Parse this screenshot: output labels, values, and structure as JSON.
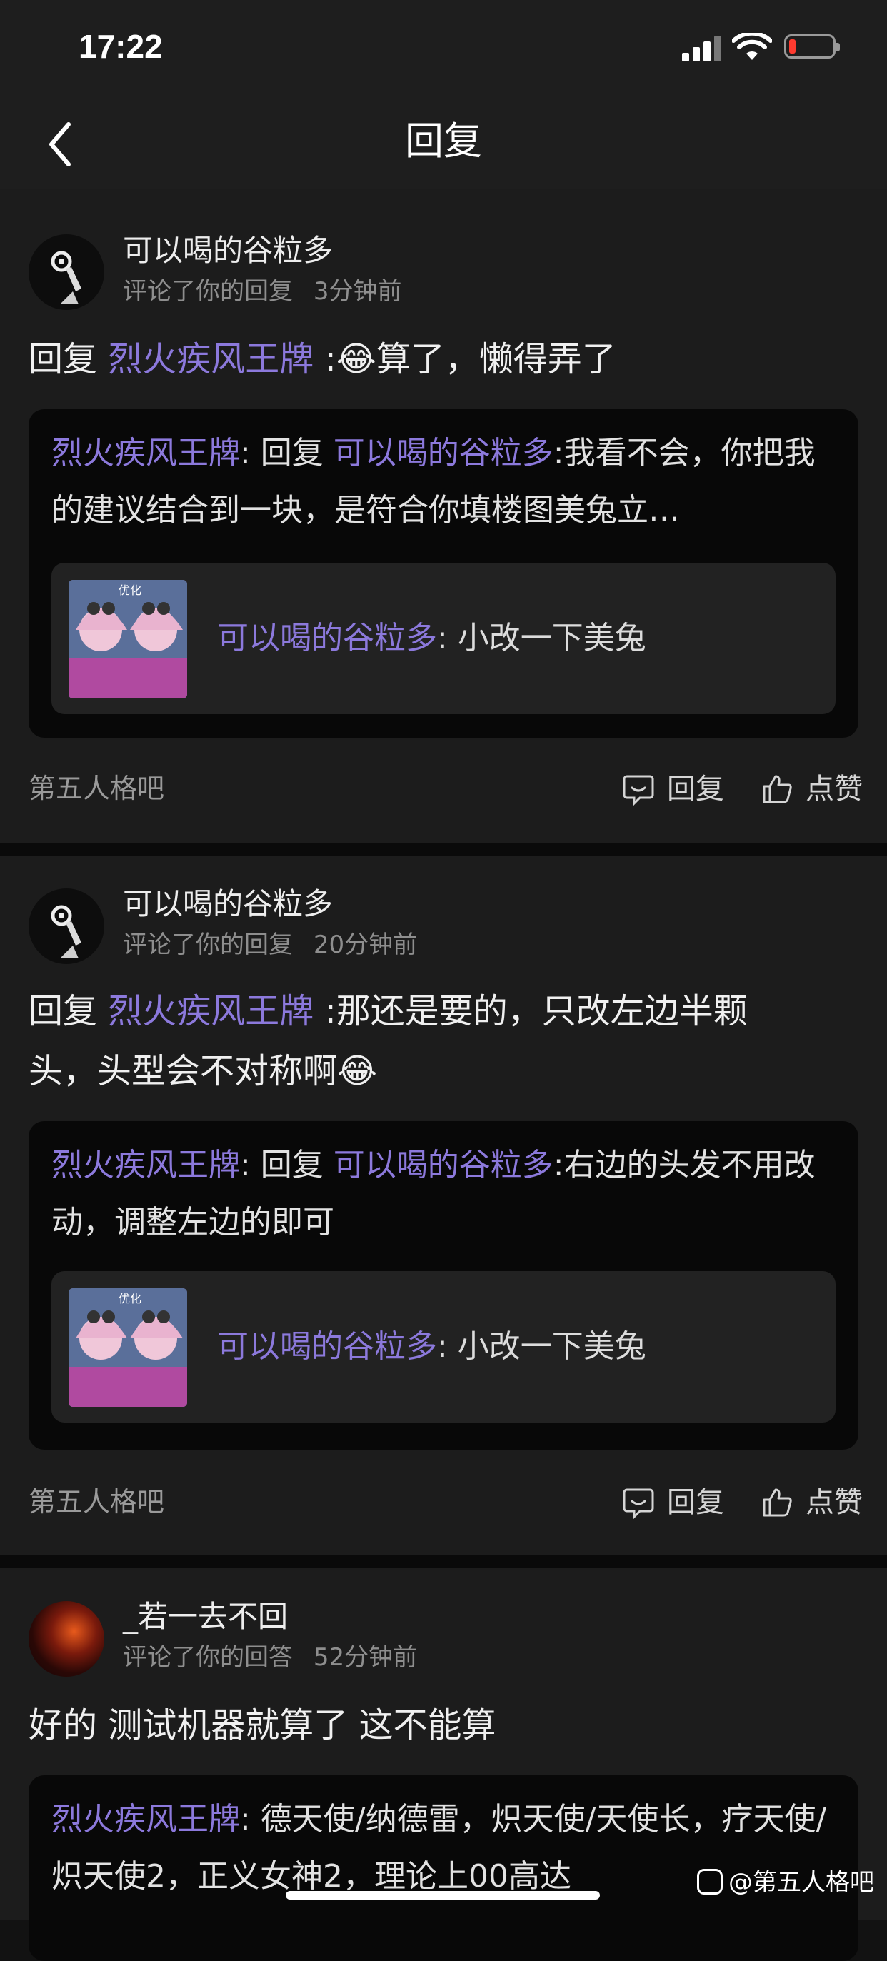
{
  "status_bar": {
    "time": "17:22"
  },
  "nav": {
    "title": "回复"
  },
  "cards": [
    {
      "username": "可以喝的谷粒多",
      "action": "评论了你的回复",
      "time": "3分钟前",
      "reply_prefix": "回复",
      "reply_to": "烈火疾风王牌",
      "reply_text": ":😂算了，懒得弄了",
      "quote_author": "烈火疾风王牌",
      "quote_mid": ": 回复 ",
      "quote_to": "可以喝的谷粒多",
      "quote_text": ":我看不会，你把我的建议结合到一块，是符合你填楼图美兔立…",
      "inner_user": "可以喝的谷粒多",
      "inner_text": ": 小改一下美兔",
      "thumb_label": "优化",
      "forum": "第五人格吧",
      "reply_label": "回复",
      "like_label": "点赞"
    },
    {
      "username": "可以喝的谷粒多",
      "action": "评论了你的回复",
      "time": "20分钟前",
      "reply_prefix": "回复",
      "reply_to": "烈火疾风王牌",
      "reply_text": ":那还是要的，只改左边半颗头，头型会不对称啊😂",
      "quote_author": "烈火疾风王牌",
      "quote_mid": ": 回复 ",
      "quote_to": "可以喝的谷粒多",
      "quote_text": ":右边的头发不用改动，调整左边的即可",
      "inner_user": "可以喝的谷粒多",
      "inner_text": ": 小改一下美兔",
      "thumb_label": "优化",
      "forum": "第五人格吧",
      "reply_label": "回复",
      "like_label": "点赞"
    },
    {
      "username": "_若一去不回",
      "action": "评论了你的回答",
      "time": "52分钟前",
      "reply_text": "好的 测试机器就算了 这不能算",
      "quote_author": "烈火疾风王牌",
      "quote_text": ": 德天使/纳德雷，炽天使/天使长，疗天使/炽天使2，正义女神2，理论上00高达"
    }
  ],
  "watermark": "@第五人格吧"
}
